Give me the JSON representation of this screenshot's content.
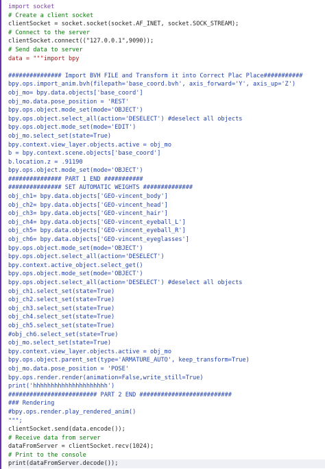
{
  "editor": {
    "lines": [
      {
        "text": "import socket",
        "kind": "kw"
      },
      {
        "text": "# Create a client socket",
        "kind": "com"
      },
      {
        "text": "clientSocket = socket.socket(socket.AF_INET, socket.SOCK_STREAM);",
        "kind": "plain"
      },
      {
        "text": "# Connect to the server",
        "kind": "com"
      },
      {
        "text": "clientSocket.connect((\"127.0.0.1\",9090));",
        "kind": "plain"
      },
      {
        "text": "# Send data to server",
        "kind": "com"
      },
      {
        "text": "data = \"\"\"import bpy",
        "kind": "str"
      },
      {
        "text": "",
        "kind": "plain"
      },
      {
        "text": "############### Import BVH FILE and Transform it into Correct Plac Place###########",
        "kind": "bl"
      },
      {
        "text": "bpy.ops.import_anim.bvh(filepath='base_coord.bvh', axis_forward='Y', axis_up='Z')",
        "kind": "bl"
      },
      {
        "text": "obj_mo= bpy.data.objects['base_coord']",
        "kind": "bl"
      },
      {
        "text": "obj_mo.data.pose_position = 'REST'",
        "kind": "bl"
      },
      {
        "text": "bpy.ops.object.mode_set(mode='OBJECT')",
        "kind": "bl"
      },
      {
        "text": "bpy.ops.object.select_all(action='DESELECT') #deselect all objects",
        "kind": "bl"
      },
      {
        "text": "bpy.ops.object.mode_set(mode='EDIT')",
        "kind": "bl"
      },
      {
        "text": "obj_mo.select_set(state=True)",
        "kind": "bl"
      },
      {
        "text": "bpy.context.view_layer.objects.active = obj_mo",
        "kind": "bl"
      },
      {
        "text": "b = bpy.context.scene.objects['base_coord']",
        "kind": "bl"
      },
      {
        "text": "b.location.z = .91190",
        "kind": "bl"
      },
      {
        "text": "bpy.ops.object.mode_set(mode='OBJECT')",
        "kind": "bl"
      },
      {
        "text": "############### PART 1 END ###########",
        "kind": "bl"
      },
      {
        "text": "############### SET AUTOMATIC WEIGHTS ##############",
        "kind": "bl"
      },
      {
        "text": "obj_ch1= bpy.data.objects['GEO-vincent_body']",
        "kind": "bl"
      },
      {
        "text": "obj_ch2= bpy.data.objects['GEO-vincent_head']",
        "kind": "bl"
      },
      {
        "text": "obj_ch3= bpy.data.objects['GEO-vincent_hair']",
        "kind": "bl"
      },
      {
        "text": "obj_ch4= bpy.data.objects['GEO-vincent_eyeball_L']",
        "kind": "bl"
      },
      {
        "text": "obj_ch5= bpy.data.objects['GEO-vincent_eyeball_R']",
        "kind": "bl"
      },
      {
        "text": "obj_ch6= bpy.data.objects['GEO-vincent_eyeglasses']",
        "kind": "bl"
      },
      {
        "text": "bpy.ops.object.mode_set(mode='OBJECT')",
        "kind": "bl"
      },
      {
        "text": "bpy.ops.object.select_all(action='DESELECT')",
        "kind": "bl"
      },
      {
        "text": "bpy.context.active_object.select_get()",
        "kind": "bl"
      },
      {
        "text": "bpy.ops.object.mode_set(mode='OBJECT')",
        "kind": "bl"
      },
      {
        "text": "bpy.ops.object.select_all(action='DESELECT') #deselect all objects",
        "kind": "bl"
      },
      {
        "text": "obj_ch1.select_set(state=True)",
        "kind": "bl"
      },
      {
        "text": "obj_ch2.select_set(state=True)",
        "kind": "bl"
      },
      {
        "text": "obj_ch3.select_set(state=True)",
        "kind": "bl"
      },
      {
        "text": "obj_ch4.select_set(state=True)",
        "kind": "bl"
      },
      {
        "text": "obj_ch5.select_set(state=True)",
        "kind": "bl"
      },
      {
        "text": "#obj_ch6.select_set(state=True)",
        "kind": "bl"
      },
      {
        "text": "obj_mo.select_set(state=True)",
        "kind": "bl"
      },
      {
        "text": "bpy.context.view_layer.objects.active = obj_mo",
        "kind": "bl"
      },
      {
        "text": "bpy.ops.object.parent_set(type='ARMATURE_AUTO', keep_transform=True)",
        "kind": "bl"
      },
      {
        "text": "obj_mo.data.pose_position = 'POSE'",
        "kind": "bl"
      },
      {
        "text": "bpy.ops.render.render(animation=False,write_still=True)",
        "kind": "bl"
      },
      {
        "text": "print('hhhhhhhhhhhhhhhhhhhhh')",
        "kind": "bl"
      },
      {
        "text": "######################### PART 2 END ##########################",
        "kind": "bl"
      },
      {
        "text": "### Rendering",
        "kind": "bl"
      },
      {
        "text": "#bpy.ops.render.play_rendered_anim()",
        "kind": "bl"
      },
      {
        "text": "\"\"\";",
        "kind": "bl"
      },
      {
        "text": "clientSocket.send(data.encode());",
        "kind": "plain"
      },
      {
        "text": "# Receive data from server",
        "kind": "com"
      },
      {
        "text": "dataFromServer = clientSocket.recv(1024);",
        "kind": "plain"
      },
      {
        "text": "# Print to the console",
        "kind": "com"
      },
      {
        "text": "print(dataFromServer.decode());",
        "kind": "plain"
      }
    ]
  }
}
